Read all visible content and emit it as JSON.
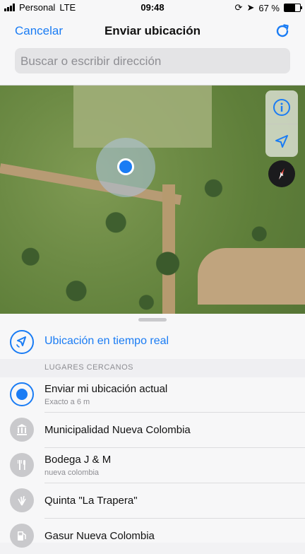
{
  "status": {
    "carrier": "Personal",
    "network": "LTE",
    "time": "09:48",
    "battery": "67 %",
    "battery_level": 0.67
  },
  "nav": {
    "cancel_label": "Cancelar",
    "title": "Enviar ubicación",
    "refresh_icon": "refresh-icon"
  },
  "search": {
    "placeholder": "Buscar o escribir dirección",
    "value": ""
  },
  "map": {
    "controls": [
      "info-icon",
      "location-arrow-icon"
    ],
    "compass_icon": "compass-icon"
  },
  "sheet": {
    "realtime_label": "Ubicación en tiempo real",
    "section_header": "LUGARES CERCANOS",
    "places": [
      {
        "title": "Enviar mi ubicación actual",
        "subtitle": "Exacto a 6 m",
        "icon": "current-location-icon"
      },
      {
        "title": "Municipalidad Nueva Colombia",
        "subtitle": "",
        "icon": "building-icon"
      },
      {
        "title": "Bodega J & M",
        "subtitle": "nueva colombia",
        "icon": "fork-knife-icon"
      },
      {
        "title": "Quinta \"La Trapera\"",
        "subtitle": "",
        "icon": "grass-icon"
      },
      {
        "title": "Gasur Nueva Colombia",
        "subtitle": "",
        "icon": "gas-pump-icon"
      }
    ]
  },
  "colors": {
    "accent": "#1a7cf4"
  }
}
